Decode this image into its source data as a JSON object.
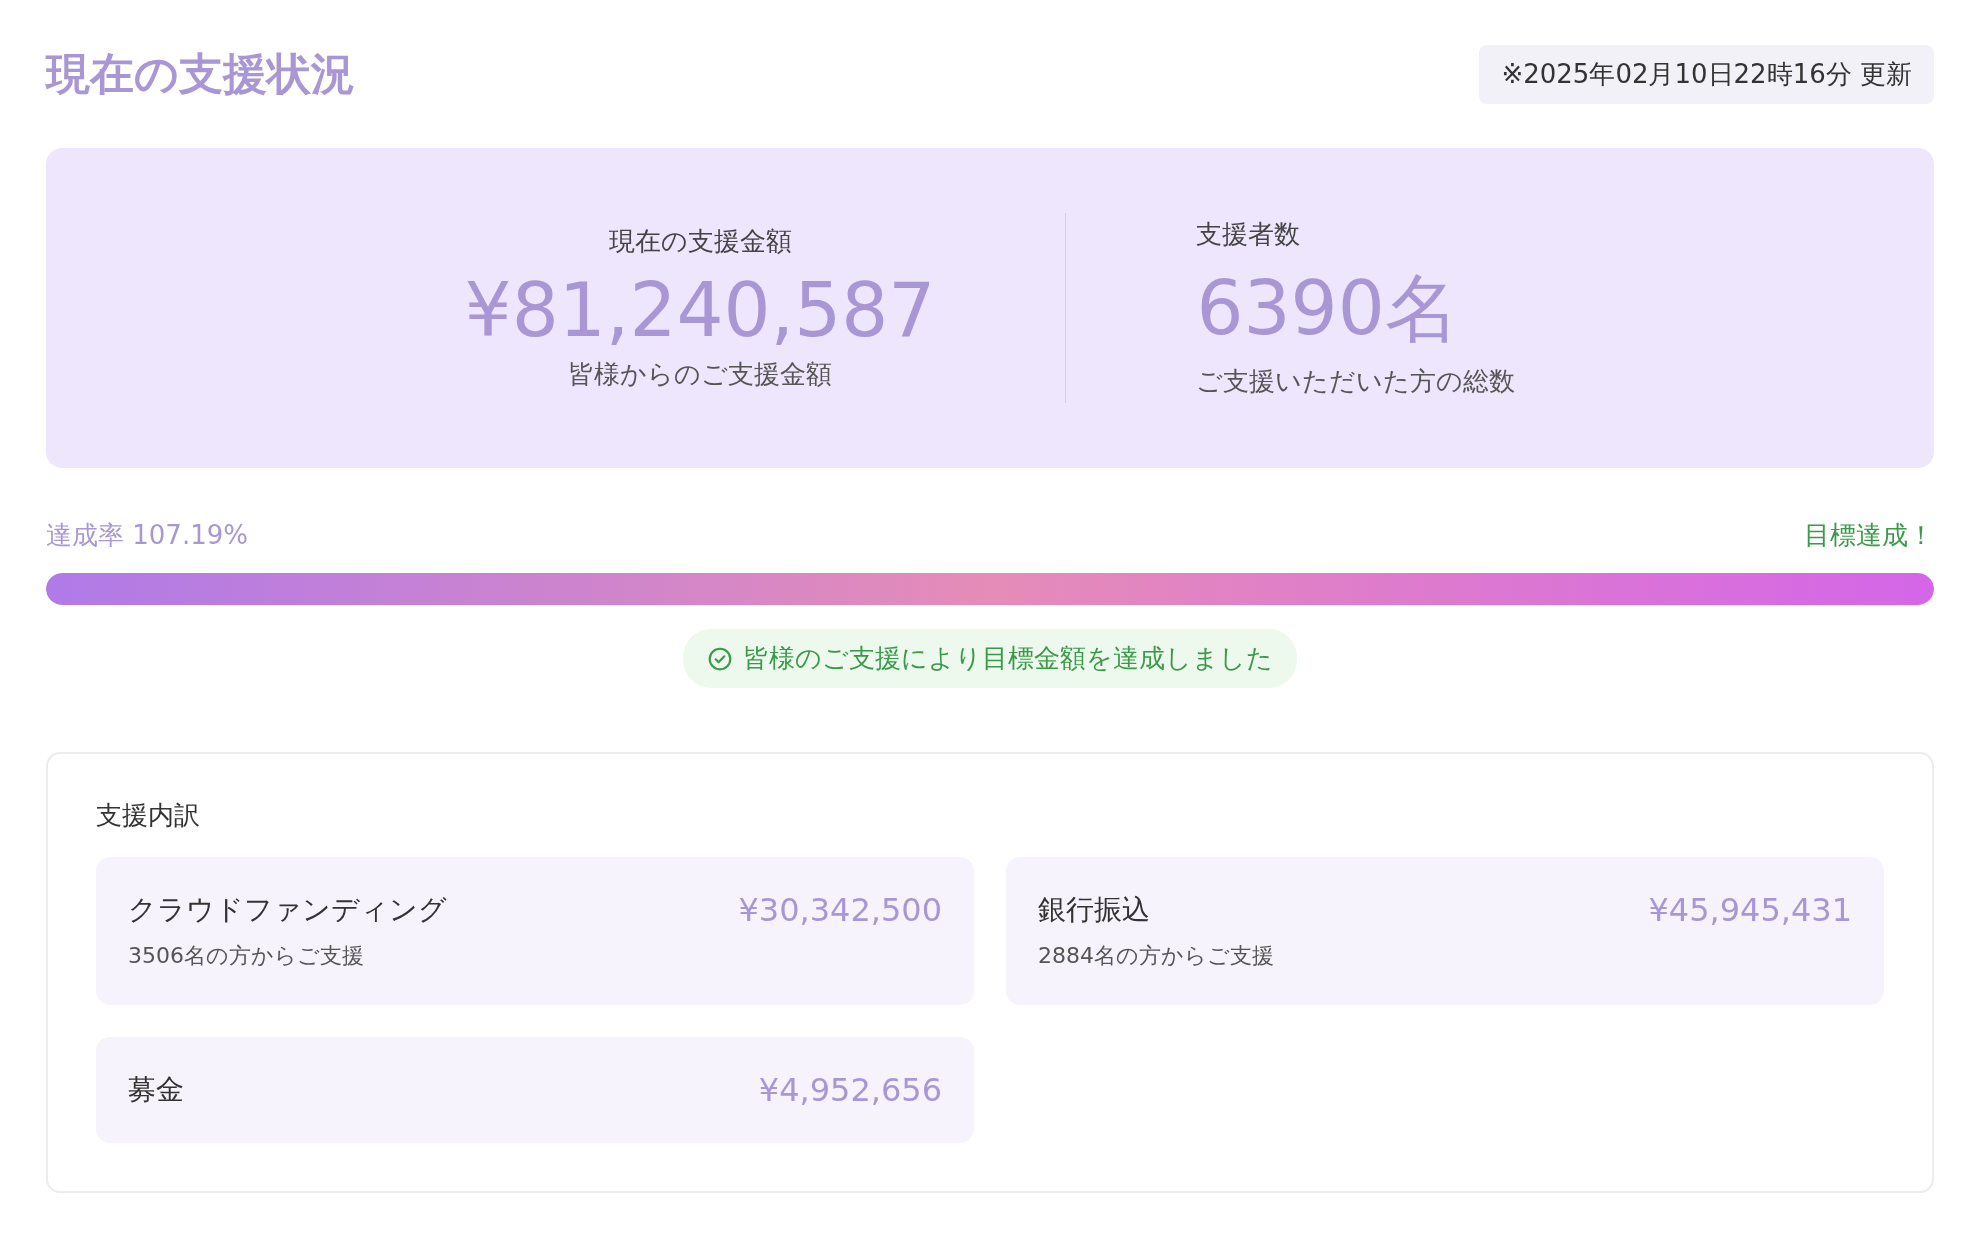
{
  "header": {
    "title": "現在の支援状況",
    "updated": "※2025年02月10日22時16分 更新"
  },
  "summary": [
    {
      "label": "現在の支援金額",
      "value": "¥81,240,587",
      "caption": "皆様からのご支援金額"
    },
    {
      "label": "支援者数",
      "value": "6390名",
      "caption": "ご支援いただいた方の総数"
    }
  ],
  "progress": {
    "label": "達成率 107.19%",
    "status": "目標達成！",
    "level": 1,
    "message": "皆様のご支援により目標金額を達成しました"
  },
  "breakdown": {
    "title": "支援内訳",
    "items": [
      {
        "name": "クラウドファンディング",
        "amount": "¥30,342,500",
        "detail": "3506名の方からご支援"
      },
      {
        "name": "銀行振込",
        "amount": "¥45,945,431",
        "detail": "2884名の方からご支援"
      },
      {
        "name": "募金",
        "amount": "¥4,952,656"
      }
    ]
  }
}
